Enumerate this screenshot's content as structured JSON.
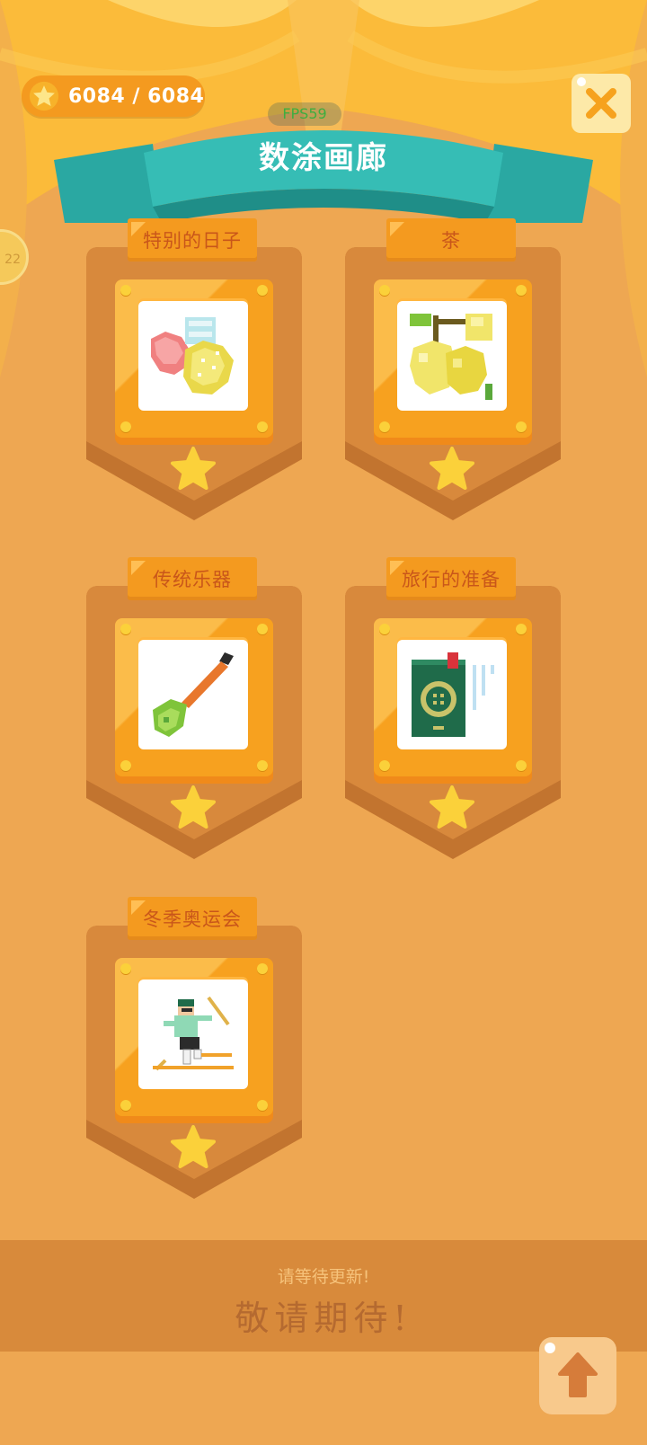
{
  "header": {
    "score_text": "6084 / 6084",
    "fps_text": "FPS59",
    "title": "数涂画廊",
    "level_badge_text": "22"
  },
  "albums": [
    {
      "label": "特别的日子",
      "art": "fruit-pixel-art"
    },
    {
      "label": "茶",
      "art": "lemon-pixel-art"
    },
    {
      "label": "传统乐器",
      "art": "instrument-pixel-art"
    },
    {
      "label": "旅行的准备",
      "art": "passport-pixel-art"
    },
    {
      "label": "冬季奥运会",
      "art": "skier-pixel-art"
    }
  ],
  "footer": {
    "subtitle": "请等待更新!",
    "message": "敬请期待!"
  },
  "colors": {
    "background": "#eea752",
    "accent_orange": "#f49a1f",
    "banner_teal": "#2fb2aa",
    "star_yellow": "#fbd13a",
    "close_x": "#f6a21e"
  },
  "icons": {
    "close": "close-icon",
    "scroll_top": "arrow-up-icon",
    "star": "star-icon"
  }
}
